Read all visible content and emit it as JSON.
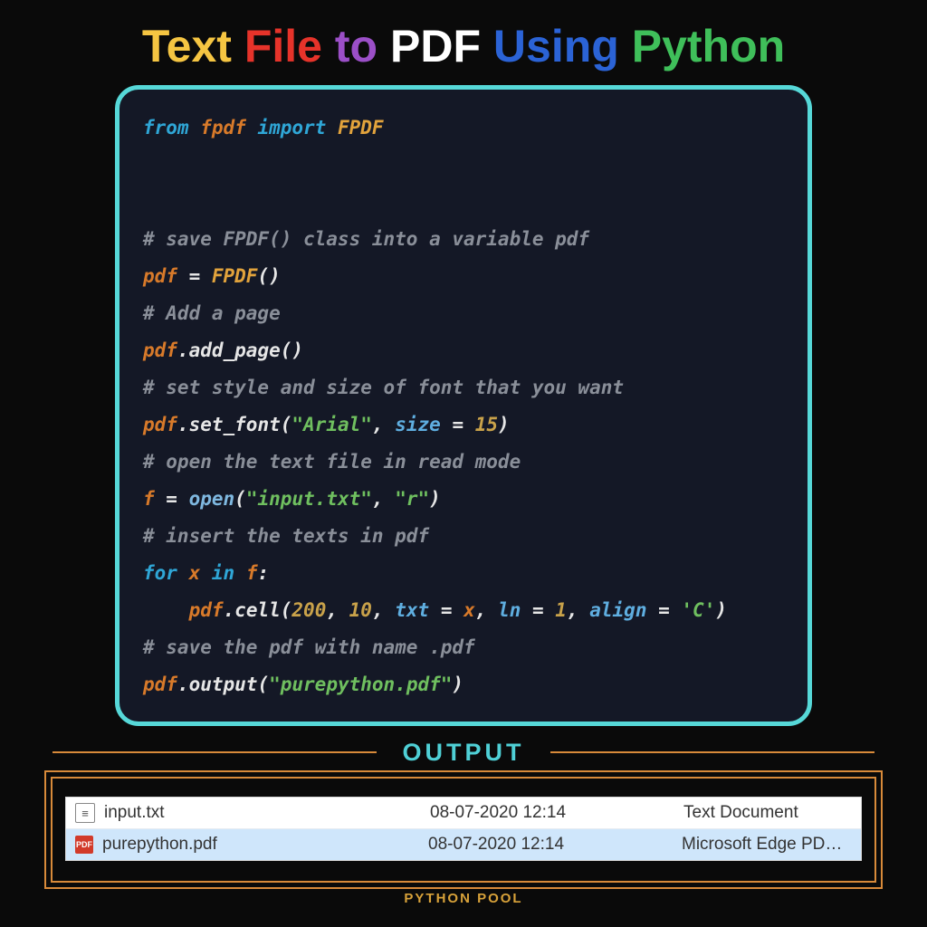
{
  "title": {
    "w1": "Text",
    "w2": "File",
    "w3": "to",
    "w4": "PDF",
    "w5": "Using",
    "w6": "Python"
  },
  "code": {
    "l1_from": "from",
    "l1_mod": "fpdf",
    "l1_import": "import",
    "l1_cls": "FPDF",
    "c1": "# save FPDF() class into a variable pdf",
    "l2_var": "pdf",
    "l2_eq": " = ",
    "l2_cls": "FPDF",
    "l2_par": "()",
    "c2": "# Add a page",
    "l3_var": "pdf",
    "l3_dot": ".",
    "l3_fn": "add_page",
    "l3_par": "()",
    "c3": "# set style and size of font that you want",
    "l4_var": "pdf",
    "l4_fn": "set_font",
    "l4_str": "\"Arial\"",
    "l4_arg": "size",
    "l4_num": "15",
    "c4": "# open the text file in read mode",
    "l5_var": "f",
    "l5_fn": "open",
    "l5_s1": "\"input.txt\"",
    "l5_s2": "\"r\"",
    "c5": "# insert the texts in pdf",
    "l6_for": "for",
    "l6_x": "x",
    "l6_in": "in",
    "l6_f": "f",
    "l7_var": "pdf",
    "l7_fn": "cell",
    "l7_n1": "200",
    "l7_n2": "10",
    "l7_a1": "txt",
    "l7_v1": "x",
    "l7_a2": "ln",
    "l7_v2": "1",
    "l7_a3": "align",
    "l7_v3": "'C'",
    "c6": "# save the pdf with name .pdf",
    "l8_var": "pdf",
    "l8_fn": "output",
    "l8_str": "\"purepython.pdf\""
  },
  "output": {
    "label": "OUTPUT",
    "rows": [
      {
        "name": "input.txt",
        "date": "08-07-2020 12:14",
        "type": "Text Document",
        "icon": "txt",
        "selected": false
      },
      {
        "name": "purepython.pdf",
        "date": "08-07-2020 12:14",
        "type": "Microsoft Edge PD…",
        "icon": "pdf",
        "selected": true
      }
    ]
  },
  "footer": "PYTHON POOL"
}
